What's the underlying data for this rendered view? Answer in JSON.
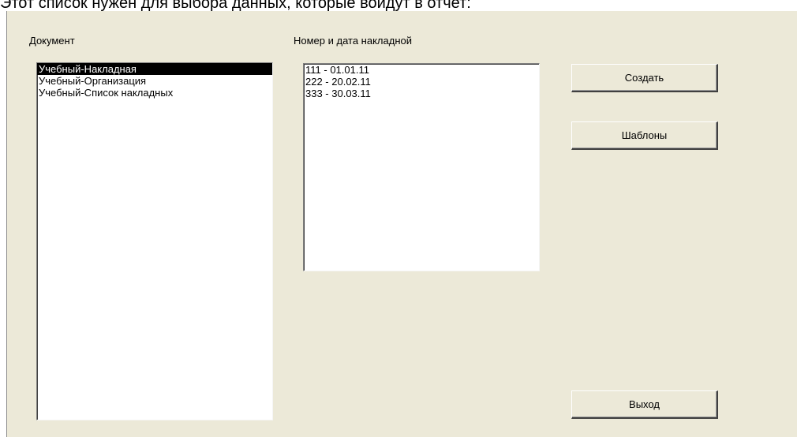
{
  "caption": "Этот список нужен для выбора данных, которые войдут в отчет:",
  "documents": {
    "label": "Документ",
    "items": [
      {
        "text": "Учебный-Накладная",
        "selected": true
      },
      {
        "text": "Учебный-Организация",
        "selected": false
      },
      {
        "text": "Учебный-Список накладных",
        "selected": false
      }
    ]
  },
  "invoices": {
    "label": "Номер и дата накладной",
    "items": [
      {
        "text": "111 - 01.01.11"
      },
      {
        "text": "222 - 20.02.11"
      },
      {
        "text": "333 - 30.03.11"
      }
    ]
  },
  "buttons": {
    "create": "Создать",
    "templates": "Шаблоны",
    "exit": "Выход"
  },
  "colors": {
    "dialog_background": "#ece9d8",
    "selection": "#000000"
  }
}
